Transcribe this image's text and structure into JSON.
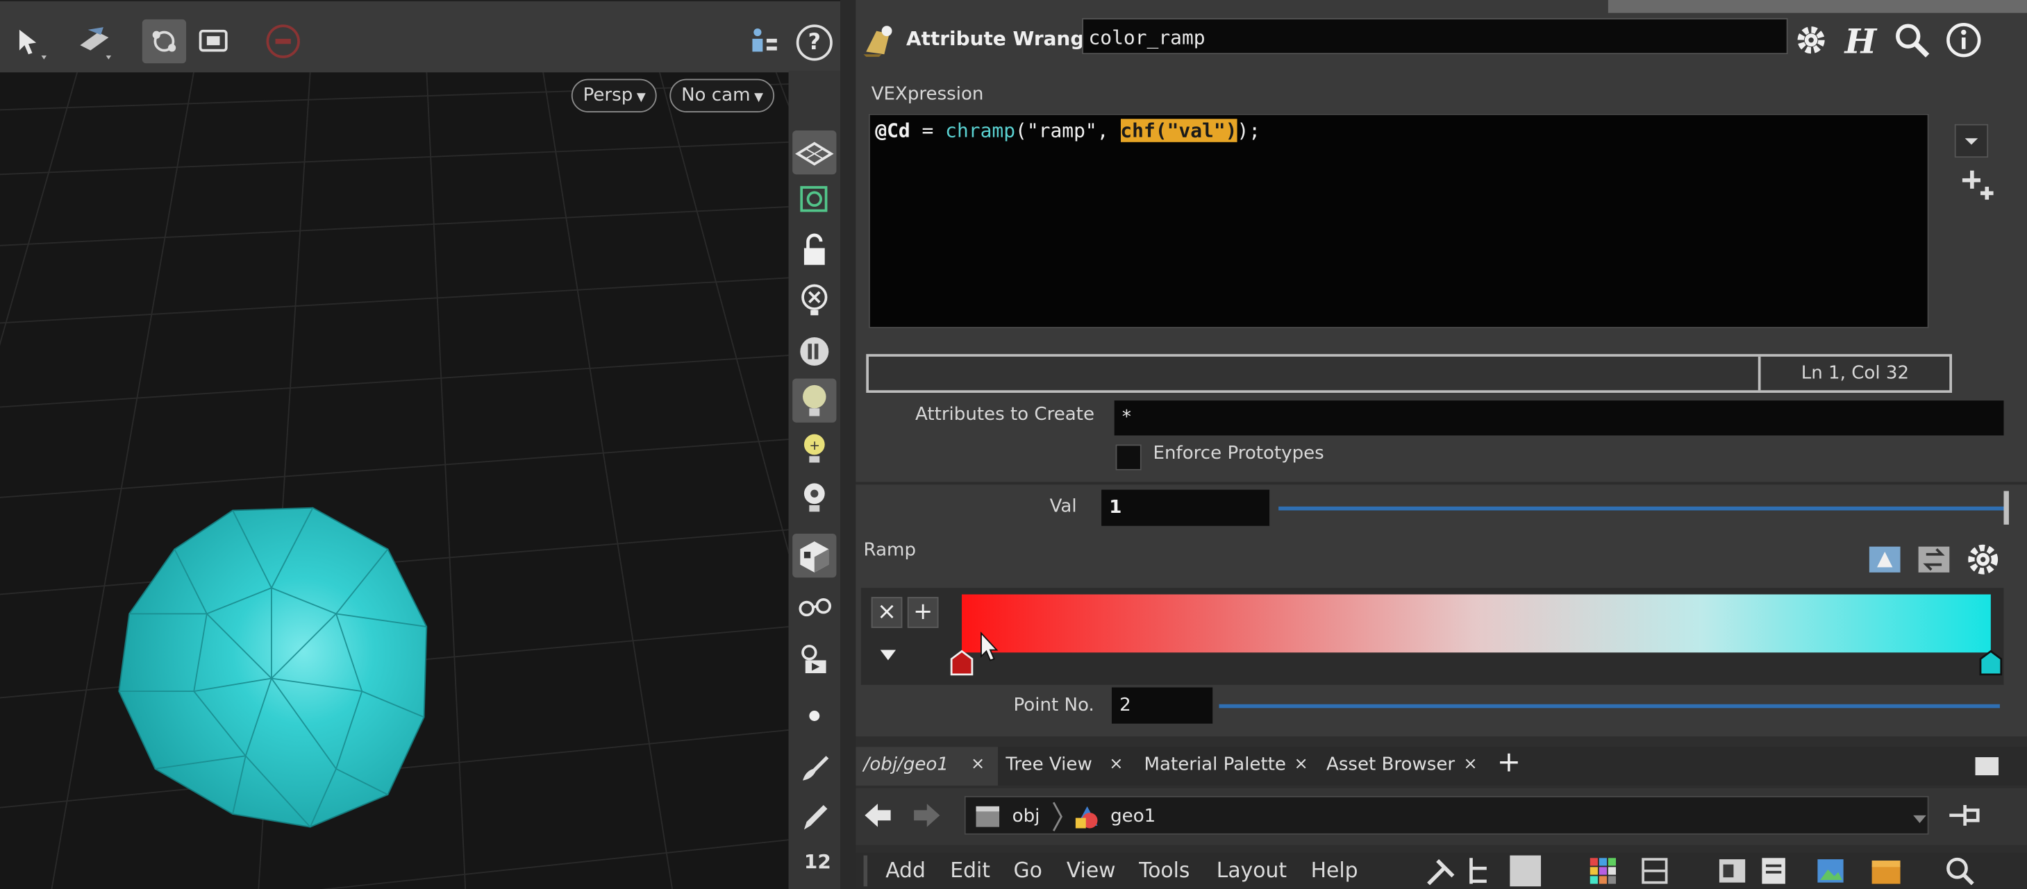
{
  "viewport": {
    "persp_label": "Persp",
    "cam_label": "No cam",
    "help_label": "?",
    "frame_number": "12"
  },
  "params": {
    "node_type": "Attribute Wrangle",
    "node_name": "color_ramp",
    "vex_label": "VEXpression",
    "code": {
      "var": "@Cd",
      "eq": " = ",
      "fn": "chramp",
      "open": "(",
      "str": "\"ramp\"",
      "comma": ", ",
      "highlight": "chf(\"val\")",
      "close": ");"
    },
    "status": "Ln 1, Col 32",
    "attributes_label": "Attributes to Create",
    "attributes_value": "*",
    "enforce_label": "Enforce Prototypes",
    "val_label": "Val",
    "val_value": "1",
    "ramp_label": "Ramp",
    "ramp_delete": "×",
    "ramp_add": "+",
    "ramp_colors": [
      "#ff1414",
      "#16e3e3"
    ],
    "point_label": "Point No.",
    "point_value": "2"
  },
  "network": {
    "tabs": [
      {
        "label": "/obj/geo1",
        "close": "×"
      },
      {
        "label": "Tree View",
        "close": "×"
      },
      {
        "label": "Material Palette",
        "close": "×"
      },
      {
        "label": "Asset Browser",
        "close": "×"
      }
    ],
    "add_tab": "+",
    "path": [
      "obj",
      "geo1"
    ],
    "menus": [
      "Add",
      "Edit",
      "Go",
      "View",
      "Tools",
      "Layout",
      "Help"
    ]
  },
  "colors": {
    "sphere": "#2ec4c6",
    "highlight": "#e7a526",
    "slider": "#2f6fb3"
  }
}
